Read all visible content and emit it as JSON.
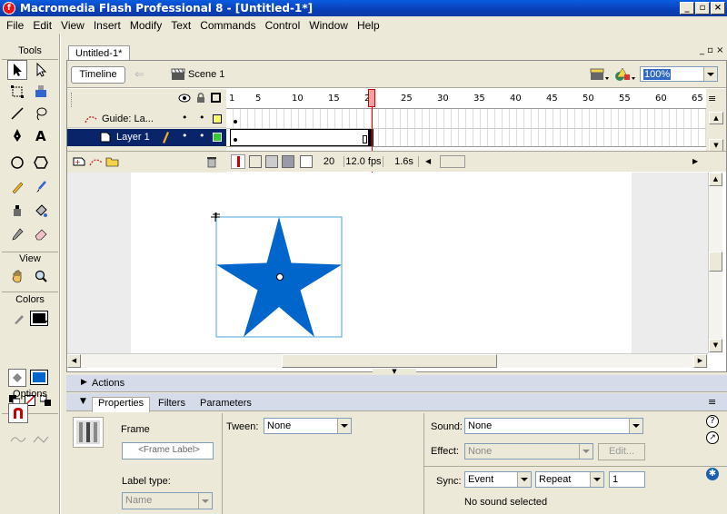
{
  "window": {
    "title": "Macromedia Flash Professional 8 - [Untitled-1*]",
    "app_icon": "flash-f-icon"
  },
  "menu": [
    "File",
    "Edit",
    "View",
    "Insert",
    "Modify",
    "Text",
    "Commands",
    "Control",
    "Window",
    "Help"
  ],
  "tools_panel": {
    "title": "Tools",
    "view_label": "View",
    "colors_label": "Colors",
    "options_label": "Options"
  },
  "colors": {
    "stroke": "#000000",
    "fill": "#0066cc",
    "star": "#0066cc",
    "playhead": "#ff0000"
  },
  "document": {
    "tab": "Untitled-1*",
    "timeline_button": "Timeline",
    "scene": "Scene 1",
    "zoom": "100%"
  },
  "timeline": {
    "frame_numbers": [
      "1",
      "5",
      "10",
      "15",
      "20",
      "25",
      "30",
      "35",
      "40",
      "45",
      "50",
      "55",
      "60",
      "65"
    ],
    "layers": [
      {
        "name": "Guide: La...",
        "type": "guide"
      },
      {
        "name": "Layer 1",
        "type": "normal"
      }
    ],
    "current_frame": "20",
    "fps": "12.0 fps",
    "time": "1.6s"
  },
  "panel": {
    "actions_label": "Actions",
    "tabs": [
      "Properties",
      "Filters",
      "Parameters"
    ],
    "frame_label": "Frame",
    "frame_label_placeholder": "<Frame Label>",
    "label_type_label": "Label type:",
    "label_type_value": "Name",
    "tween_label": "Tween:",
    "tween_value": "None",
    "sound_label": "Sound:",
    "sound_value": "None",
    "effect_label": "Effect:",
    "effect_value": "None",
    "edit_button": "Edit...",
    "sync_label": "Sync:",
    "sync_value": "Event",
    "repeat_value": "Repeat",
    "repeat_count": "1",
    "sound_status": "No sound selected"
  }
}
